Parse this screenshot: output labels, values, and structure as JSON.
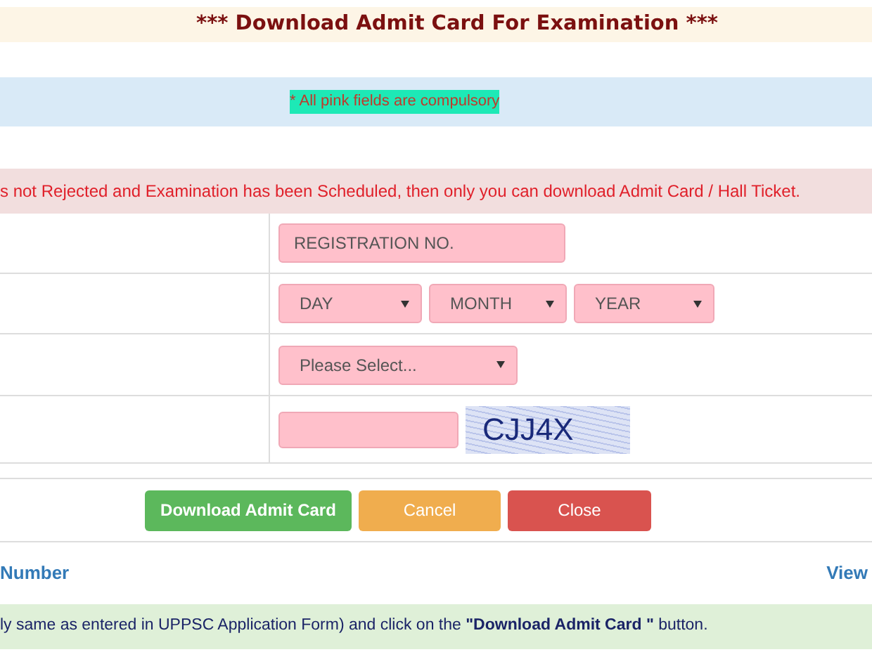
{
  "title": "*** Download Admit Card For Examination ***",
  "notice": "* All pink fields are compulsory",
  "warning": "s not Rejected and Examination has been Scheduled, then only you can download Admit Card / Hall Ticket.",
  "form_rows": [
    {
      "kind": "text",
      "placeholder": "REGISTRATION NO."
    },
    {
      "kind": "selects",
      "options": [
        "DAY",
        "MONTH",
        "YEAR"
      ]
    },
    {
      "kind": "select",
      "value": "Please Select..."
    },
    {
      "kind": "captcha",
      "captcha": "CJJ4X"
    }
  ],
  "buttons": [
    {
      "label": "Download Admit Card",
      "color": "#5cb85c"
    },
    {
      "label": "Cancel",
      "color": "#f0ad4e"
    },
    {
      "label": "Close",
      "color": "#d9534f"
    }
  ],
  "links": [
    "Number",
    "View"
  ],
  "instruction": "ly same as entered in UPPSC Application Form) and click on the **\"Download Admit Card \"** button."
}
